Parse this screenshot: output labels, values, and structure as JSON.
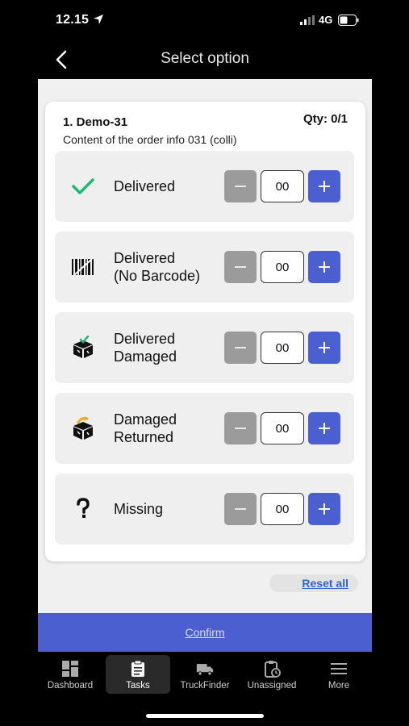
{
  "status_bar": {
    "time": "12.15",
    "network": "4G"
  },
  "header": {
    "title": "Select option"
  },
  "order": {
    "title": "1. Demo-31",
    "qty": "Qty: 0/1",
    "description": "Content of the order info 031  (colli)"
  },
  "options": [
    {
      "label_line1": "Delivered",
      "label_line2": "",
      "value": "00",
      "icon": "check-icon"
    },
    {
      "label_line1": "Delivered",
      "label_line2": "(No Barcode)",
      "value": "00",
      "icon": "barcode-icon"
    },
    {
      "label_line1": "Delivered",
      "label_line2": "Damaged",
      "value": "00",
      "icon": "damaged-box-icon"
    },
    {
      "label_line1": "Damaged",
      "label_line2": "Returned",
      "value": "00",
      "icon": "returned-box-icon"
    },
    {
      "label_line1": "Missing",
      "label_line2": "",
      "value": "00",
      "icon": "question-icon"
    }
  ],
  "actions": {
    "reset_label": "Reset all",
    "confirm_label": "Confirm"
  },
  "tabs": [
    {
      "label": "Dashboard",
      "icon": "dashboard-icon"
    },
    {
      "label": "Tasks",
      "icon": "clipboard-icon",
      "active": true
    },
    {
      "label": "TruckFinder",
      "icon": "truck-icon"
    },
    {
      "label": "Unassigned",
      "icon": "clipboard-clock-icon"
    },
    {
      "label": "More",
      "icon": "menu-icon"
    }
  ],
  "colors": {
    "accent": "#4b5fd0",
    "check": "#22b573",
    "link": "#2d63d8"
  }
}
